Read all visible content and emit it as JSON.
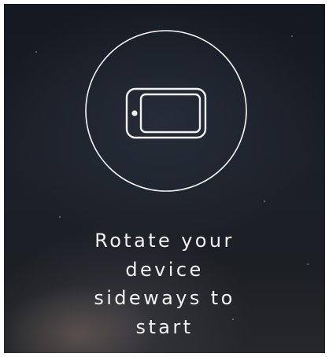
{
  "prompt": {
    "message": "Rotate your\ndevice\nsideways to\nstart",
    "icon": "rotate-device-icon"
  },
  "colors": {
    "background_top": "#141820",
    "background_bottom": "#26272a",
    "foreground": "#f2f2f2"
  }
}
